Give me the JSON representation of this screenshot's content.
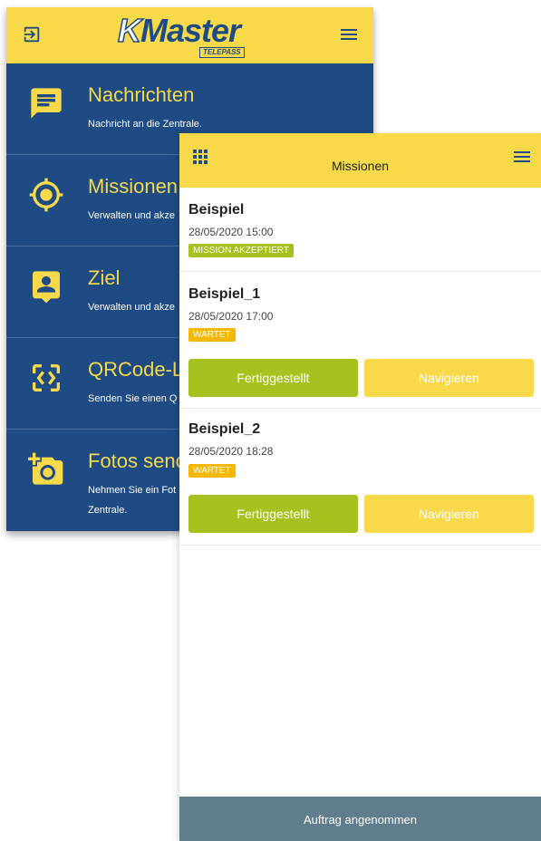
{
  "menu_screen": {
    "logo": {
      "text_k": "K",
      "text_rest": "Master",
      "sub": "TELEPASS"
    },
    "items": [
      {
        "title": "Nachrichten",
        "desc": "Nachricht an die Zentrale.",
        "icon": "message-icon"
      },
      {
        "title": "Missionen",
        "desc": "Verwalten und akze",
        "icon": "target-icon"
      },
      {
        "title": "Ziel",
        "desc": "Verwalten und akze",
        "icon": "contact-icon"
      },
      {
        "title": "QRCode-Le",
        "desc": "Senden Sie einen Q",
        "icon": "qrcode-icon"
      },
      {
        "title": "Fotos senc",
        "desc": "Nehmen Sie ein Fot",
        "desc2": "Zentrale.",
        "icon": "add-photo-icon"
      }
    ]
  },
  "missions_screen": {
    "title": "Missionen",
    "missions": [
      {
        "name": "Beispiel",
        "datetime": "28/05/2020 15:00",
        "status": "MISSION AKZEPTIERT"
      },
      {
        "name": "Beispiel_1",
        "datetime": "28/05/2020 17:00",
        "status": "WARTET",
        "done_label": "Fertiggestellt",
        "nav_label": "Navigieren"
      },
      {
        "name": "Beispiel_2",
        "datetime": "28/05/2020 18:28",
        "status": "WARTET",
        "done_label": "Fertiggestellt",
        "nav_label": "Navigieren"
      }
    ],
    "snackbar": "Auftrag angenommen"
  },
  "colors": {
    "brand_blue": "#1e4b84",
    "brand_yellow": "#f7d94a",
    "accent_green": "#a5c21f",
    "wait_orange": "#f5b700",
    "snackbar": "#607d8b"
  }
}
